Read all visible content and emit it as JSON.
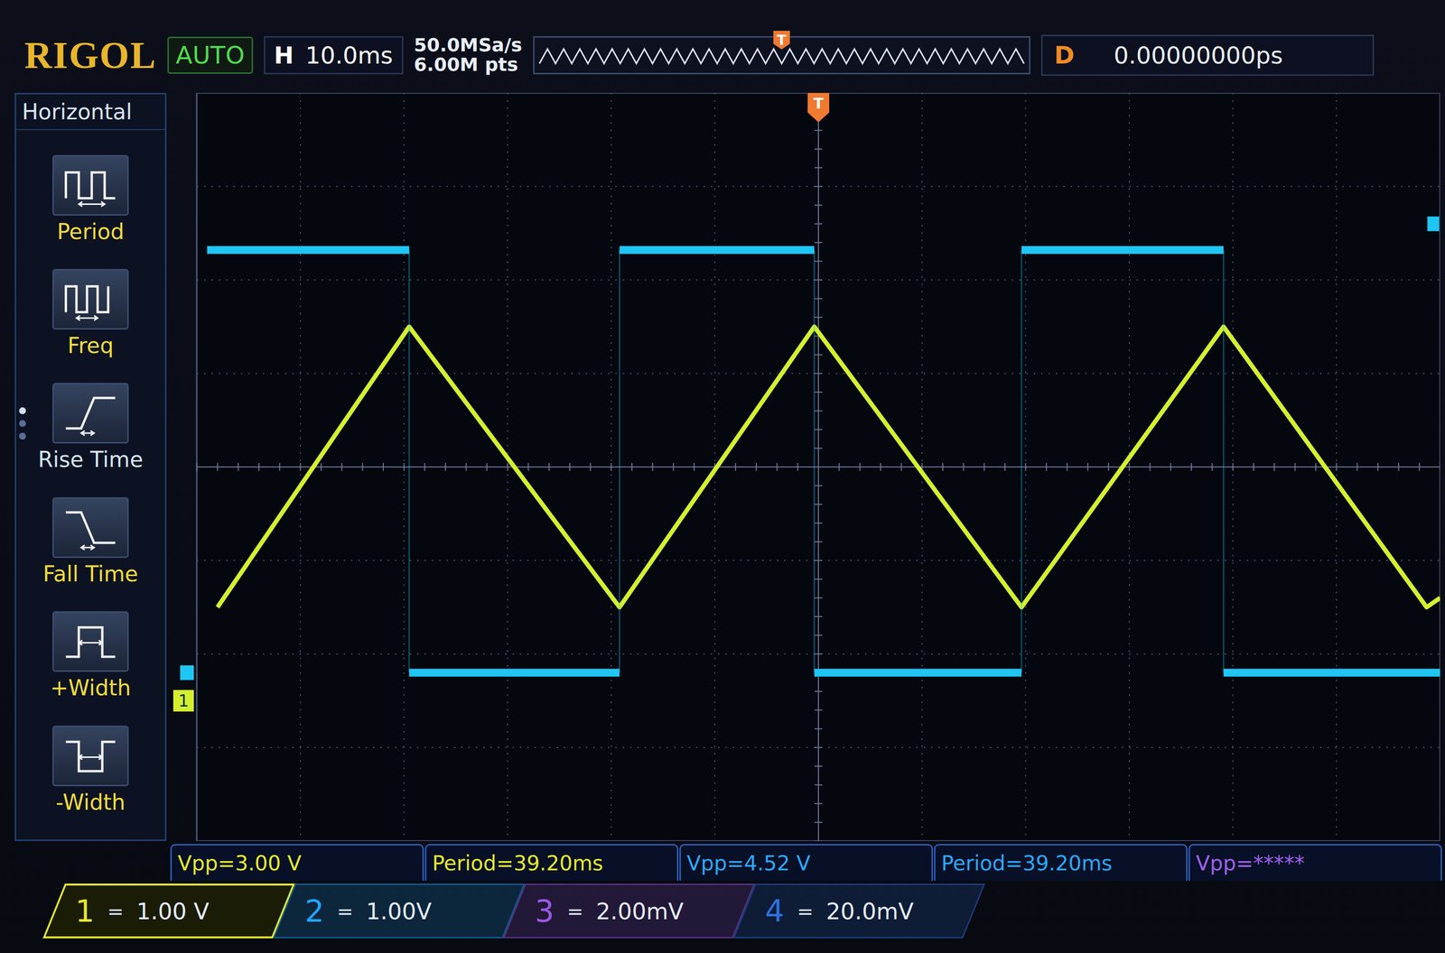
{
  "top_bar": {
    "logo": "RIGOL",
    "run_state": "AUTO",
    "timebase_label": "H",
    "timebase": "10.0ms",
    "sample_rate": "50.0MSa/s",
    "memory_depth": "6.00M pts",
    "memory_marker": "T",
    "delay_label": "D",
    "delay": "0.00000000ps"
  },
  "menu": {
    "title": "Horizontal",
    "page_indicator": [
      {
        "selected": true
      },
      {
        "selected": false
      },
      {
        "selected": false
      }
    ],
    "items": [
      {
        "label": "Period",
        "kind": "period",
        "selected": false
      },
      {
        "label": "Freq",
        "kind": "freq",
        "selected": false
      },
      {
        "label": "Rise Time",
        "kind": "rise",
        "selected": true
      },
      {
        "label": "Fall Time",
        "kind": "fall",
        "selected": false
      },
      {
        "label": "+Width",
        "kind": "pwidth",
        "selected": false
      },
      {
        "label": "-Width",
        "kind": "nwidth",
        "selected": false
      }
    ]
  },
  "chart": {
    "ms_per_div": 10,
    "divisions_x": 12,
    "divisions_y": 8,
    "trigger": {
      "label": "T",
      "time_ms": 60,
      "level_v": 4.8,
      "color": "#1ec6f5"
    },
    "series": [
      {
        "marker_label": "1",
        "kind": "line",
        "volts_per_div": 1,
        "offset_div": 2.5,
        "times_ms": [
          2,
          20.5,
          40.8,
          59.6,
          79.6,
          99.1,
          118.7,
          120
        ],
        "values_v": [
          1.0,
          4.0,
          1.0,
          4.0,
          1.0,
          4.0,
          1.0,
          1.1
        ],
        "color": "#d4f02e"
      },
      {
        "marker_label": "",
        "kind": "step",
        "volts_per_div": 1,
        "offset_div": 2.2,
        "times_ms": [
          1,
          20.5,
          40.8,
          59.6,
          79.6,
          99.1,
          120
        ],
        "values_v": [
          4.52,
          0,
          4.52,
          0,
          4.52,
          0
        ],
        "color": "#1ec6f5"
      }
    ]
  },
  "measurements": [
    {
      "text": "Vpp=3.00 V",
      "color": "#e6ea2a"
    },
    {
      "text": "Period=39.20ms",
      "color": "#e6ea2a"
    },
    {
      "text": "Vpp=4.52 V",
      "color": "#2aa8ff"
    },
    {
      "text": "Period=39.20ms",
      "color": "#2aa8ff"
    },
    {
      "text": "Vpp=*****",
      "color": "#a060ec"
    }
  ],
  "channels": [
    {
      "number": "1",
      "coupling": "=",
      "scale": "1.00 V",
      "color": "#e6ea2a",
      "selected": true
    },
    {
      "number": "2",
      "coupling": "=",
      "scale": "1.00V",
      "color": "#1fa6ff",
      "selected": false
    },
    {
      "number": "3",
      "coupling": "=",
      "scale": "2.00mV",
      "color": "#9b59e6",
      "selected": false
    },
    {
      "number": "4",
      "coupling": "=",
      "scale": "20.0mV",
      "color": "#2f6fe0",
      "selected": false
    }
  ]
}
